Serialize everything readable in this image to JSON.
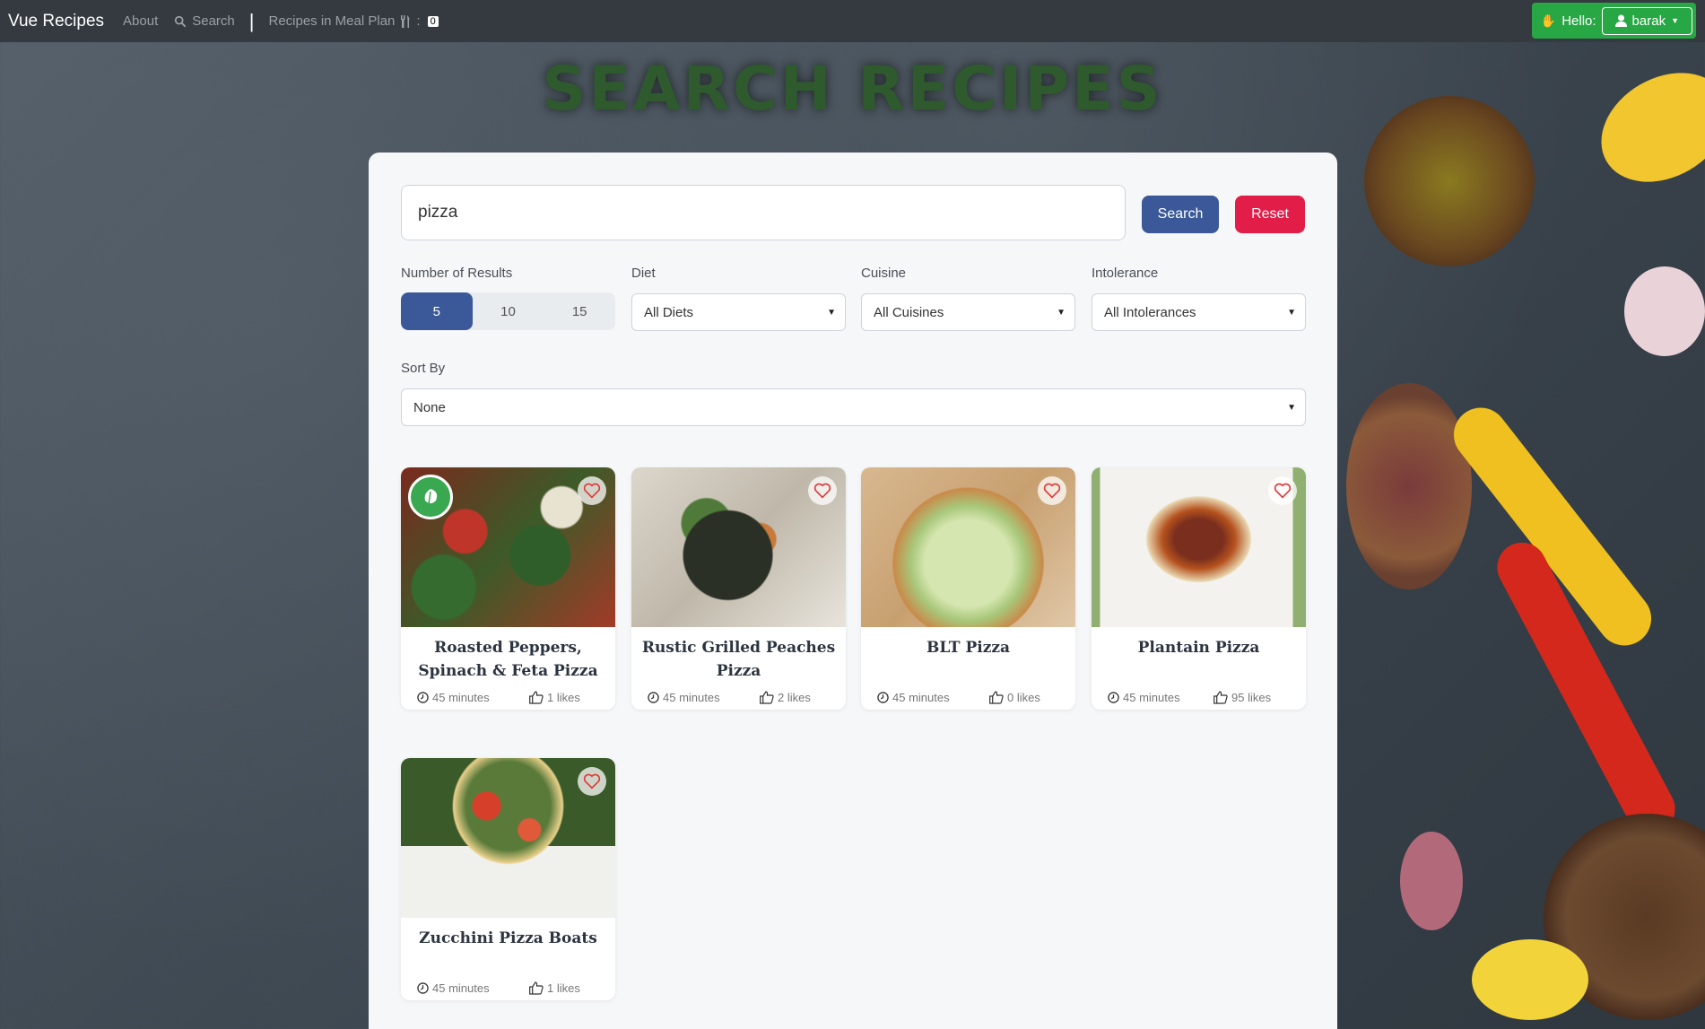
{
  "navbar": {
    "brand": "Vue Recipes",
    "about": "About",
    "search": "Search",
    "meal_plan": "Recipes in Meal Plan",
    "meal_plan_count": "0",
    "hello": "Hello:",
    "user": "barak"
  },
  "page_title": "SEARCH RECIPES",
  "search": {
    "value": "pizza",
    "search_label": "Search",
    "reset_label": "Reset"
  },
  "filters": {
    "results_label": "Number of Results",
    "results_options": [
      "5",
      "10",
      "15"
    ],
    "results_selected": "5",
    "diet_label": "Diet",
    "diet_value": "All Diets",
    "cuisine_label": "Cuisine",
    "cuisine_value": "All Cuisines",
    "intolerance_label": "Intolerance",
    "intolerance_value": "All Intolerances",
    "sort_label": "Sort By",
    "sort_value": "None"
  },
  "recipes": [
    {
      "title": "Roasted Peppers, Spinach & Feta Pizza",
      "time": "45 minutes",
      "likes": "1 likes",
      "vegetarian": true
    },
    {
      "title": "Rustic Grilled Peaches Pizza",
      "time": "45 minutes",
      "likes": "2 likes",
      "vegetarian": false
    },
    {
      "title": "BLT Pizza",
      "time": "45 minutes",
      "likes": "0 likes",
      "vegetarian": false
    },
    {
      "title": "Plantain Pizza",
      "time": "45 minutes",
      "likes": "95 likes",
      "vegetarian": false
    },
    {
      "title": "Zucchini Pizza Boats",
      "time": "45 minutes",
      "likes": "1 likes",
      "vegetarian": false
    }
  ],
  "colors": {
    "primary": "#3b5998",
    "danger": "#e11d48",
    "success": "#28a745",
    "title": "#2e5a2e"
  }
}
